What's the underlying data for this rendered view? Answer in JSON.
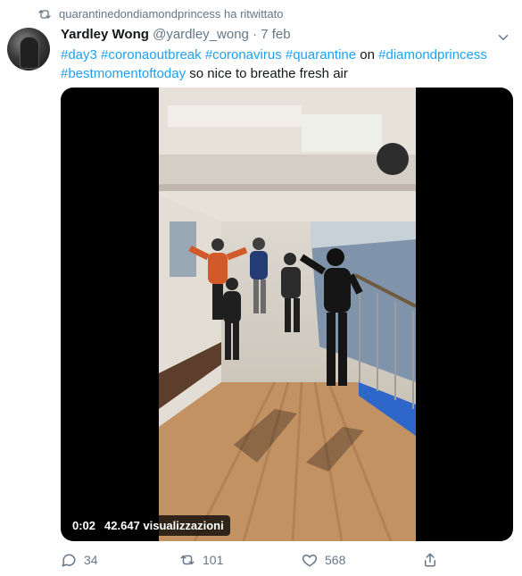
{
  "retweet": {
    "text": "quarantinedondiamondprincess ha ritwittato",
    "icon": "retweet-icon"
  },
  "author": {
    "name": "Yardley Wong",
    "handle": "@yardley_wong",
    "separator": "·",
    "date": "7 feb"
  },
  "tweet": {
    "tag1": "#day3",
    "tag2": "#coronaoutbreak",
    "tag3": "#coronavirus",
    "tag4": "#quarantine",
    "word_on": "on",
    "tag5": "#diamondprincess",
    "tag6": "#bestmomentoftoday",
    "rest": "so nice to breathe fresh air"
  },
  "video": {
    "time": "0:02",
    "views": "42.647 visualizzazioni"
  },
  "actions": {
    "replies": "34",
    "retweets": "101",
    "likes": "568"
  },
  "colors": {
    "link": "#1da1f2",
    "muted": "#657786",
    "text": "#14171a"
  }
}
